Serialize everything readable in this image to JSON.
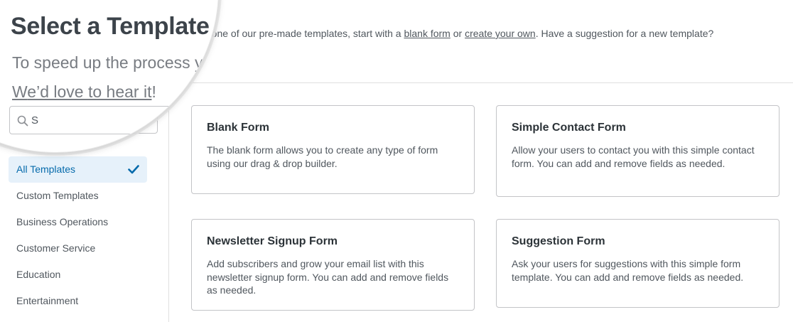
{
  "header": {
    "title": "Select a Template",
    "intro_visible_start": "n one of our pre-made templates, start with a",
    "blank_form_link": "blank form",
    "or_text": "or",
    "create_your_own_link": "create your own",
    "intro_tail": ". Have a suggestion for a new template?",
    "intro_zoomed": "To speed up the process y",
    "feedback_prefix": "W",
    "feedback_link": "e’d love to hear it",
    "feedback_suffix": "!"
  },
  "search": {
    "placeholder": "S",
    "value": ""
  },
  "sidebar": {
    "categories": [
      {
        "label": "All Templates",
        "active": true
      },
      {
        "label": "Custom Templates",
        "active": false
      },
      {
        "label": "Business Operations",
        "active": false
      },
      {
        "label": "Customer Service",
        "active": false
      },
      {
        "label": "Education",
        "active": false
      },
      {
        "label": "Entertainment",
        "active": false
      }
    ]
  },
  "templates": [
    {
      "name": "Blank Form",
      "description": "The blank form allows you to create any type of form using our drag & drop builder."
    },
    {
      "name": "Simple Contact Form",
      "description": "Allow your users to contact you with this simple contact form. You can add and remove fields as needed."
    },
    {
      "name": "Newsletter Signup Form",
      "description": "Add subscribers and grow your email list with this newsletter signup form. You can add and remove fields as needed."
    },
    {
      "name": "Suggestion Form",
      "description": "Ask your users for suggestions with this simple form template. You can add and remove fields as needed."
    }
  ],
  "colors": {
    "accent": "#056aab",
    "active_bg": "#e6f1fa",
    "border": "#c3c4c7"
  },
  "icons": {
    "search": "search-icon",
    "check": "checkmark-icon"
  }
}
